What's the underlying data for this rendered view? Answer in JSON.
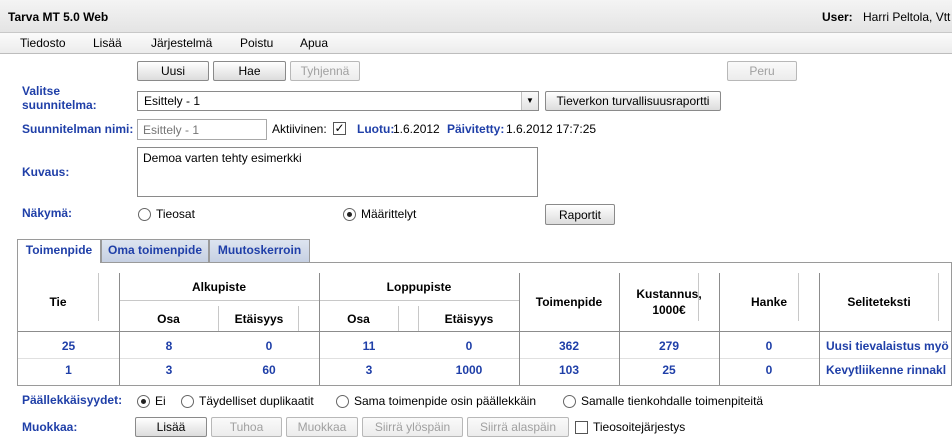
{
  "window": {
    "title": "Tarva MT 5.0 Web",
    "user_label": "User:",
    "user_name": "Harri Peltola, Vtt"
  },
  "menu": [
    {
      "label": "Tiedosto"
    },
    {
      "label": "Lisää"
    },
    {
      "label": "Järjestelmä"
    },
    {
      "label": "Poistu"
    },
    {
      "label": "Apua"
    }
  ],
  "toolbar": {
    "new": "Uusi",
    "fetch": "Hae",
    "clear": "Tyhjennä",
    "cancel": "Peru"
  },
  "form": {
    "plan_label_1": "Valitse",
    "plan_label_2": "suunnitelma:",
    "plan_value": "Esittely - 1",
    "report_button": "Tieverkon turvallisuusraportti",
    "name_label": "Suunnitelman nimi:",
    "name_placeholder": "Esittely - 1",
    "active_label": "Aktiivinen:",
    "active_checked": true,
    "created_label": "Luotu:",
    "created_value": "1.6.2012",
    "updated_label": "Päivitetty:",
    "updated_value": "1.6.2012 17:7:25",
    "desc_label": "Kuvaus:",
    "desc_value": "Demoa varten tehty esimerkki",
    "view_label": "Näkymä:",
    "view_option_1": "Tieosat",
    "view_option_2": "Määrittelyt",
    "view_selected": "Määrittelyt",
    "reports_button": "Raportit"
  },
  "tabs": [
    {
      "label": "Toimenpide",
      "active": true
    },
    {
      "label": "Oma toimenpide",
      "active": false
    },
    {
      "label": "Muutoskerroin",
      "active": false
    }
  ],
  "table": {
    "headers": {
      "tie": "Tie",
      "start_group": "Alkupiste",
      "end_group": "Loppupiste",
      "osa": "Osa",
      "etaisyys": "Etäisyys",
      "toimenpide": "Toimenpide",
      "cost_1": "Kustannus,",
      "cost_2": "1000€",
      "hanke": "Hanke",
      "selite": "Seliteteksti"
    },
    "rows": [
      [
        "25",
        "8",
        "0",
        "11",
        "0",
        "362",
        "279",
        "0",
        "Uusi tievalaistus myö"
      ],
      [
        "1",
        "3",
        "60",
        "3",
        "1000",
        "103",
        "25",
        "0",
        "Kevytliikenne rinnakl"
      ]
    ]
  },
  "overlaps": {
    "label": "Päällekkäisyydet:",
    "options": [
      "Ei",
      "Täydelliset duplikaatit",
      "Sama toimenpide osin päällekkäin",
      "Samalle tienkohdalle toimenpiteitä"
    ],
    "selected": "Ei"
  },
  "edit": {
    "label": "Muokkaa:",
    "add": "Lisää",
    "remove": "Tuhoa",
    "modify": "Muokkaa",
    "move_up": "Siirrä ylöspäin",
    "move_down": "Siirrä alaspäin",
    "order_label": "Tieosoitejärjestys",
    "order_checked": false
  }
}
